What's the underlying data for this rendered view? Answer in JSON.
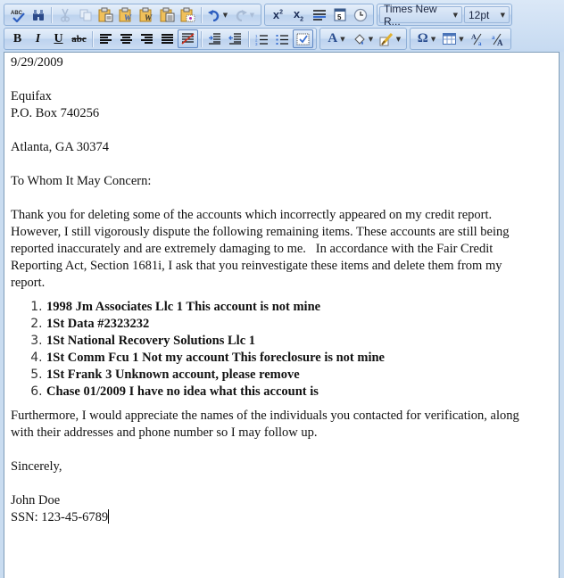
{
  "toolbar": {
    "row1": {
      "tools": [
        {
          "name": "spellcheck",
          "icon": "spellcheck-icon",
          "glyph": "ᴬᴮᶜ✓"
        },
        {
          "name": "find",
          "icon": "binoculars-icon",
          "glyph": "⚲"
        },
        {
          "name": "cut",
          "icon": "scissors-icon",
          "glyph": "✂",
          "disabled": true
        },
        {
          "name": "copy",
          "icon": "copy-icon",
          "glyph": "❐",
          "disabled": true
        },
        {
          "name": "paste",
          "icon": "paste-icon",
          "glyph": "📋"
        },
        {
          "name": "paste-from-word",
          "icon": "paste-word-icon",
          "glyph": "W"
        },
        {
          "name": "paste-as-html",
          "icon": "paste-html-icon",
          "glyph": "W"
        },
        {
          "name": "paste-plain-text",
          "icon": "paste-text-icon",
          "glyph": "≣"
        },
        {
          "name": "paste-special",
          "icon": "paste-special-icon",
          "glyph": "⊡"
        },
        {
          "name": "undo",
          "icon": "undo-icon",
          "glyph": "↶"
        },
        {
          "name": "redo",
          "icon": "redo-icon",
          "glyph": "↷",
          "disabled": true
        }
      ],
      "superscript_glyph": "x²",
      "subscript_glyph": "x₂",
      "font_name": "Times New R...",
      "font_size": "12pt"
    },
    "row2": {
      "bold": "B",
      "italic": "I",
      "underline": "U",
      "strikethrough": "abc",
      "font_color_glyph": "A",
      "special_char_glyph": "Ω"
    }
  },
  "document": {
    "date": "9/29/2009",
    "recipient": {
      "name": "Equifax",
      "address1": "P.O. Box 740256",
      "city_state_zip": "Atlanta, GA 30374"
    },
    "salutation": "To Whom It May Concern:",
    "paragraph1": "Thank you for deleting some of the accounts which incorrectly appeared on my credit report. However, I still vigorously dispute the following remaining items. These accounts are still being reported inaccurately and are extremely damaging to me.   In accordance with the Fair Credit Reporting Act, Section 1681i, I ask that you reinvestigate these items and delete them from my report.",
    "items": [
      "1998 Jm Associates Llc  1 This account is not mine",
      "1St Data #2323232",
      "1St National Recovery Solutions Llc 1",
      "1St Comm Fcu 1 Not my account This foreclosure is not mine",
      "1St Frank 3 Unknown account, please remove",
      "Chase 01/2009 I have no idea what this account is"
    ],
    "paragraph2": "Furthermore, I would appreciate the names of the individuals you contacted for verification, along with their addresses and phone number so I may follow up.",
    "closing": "Sincerely,",
    "signature_name": "John Doe",
    "ssn_line": "SSN: 123-45-6789"
  }
}
